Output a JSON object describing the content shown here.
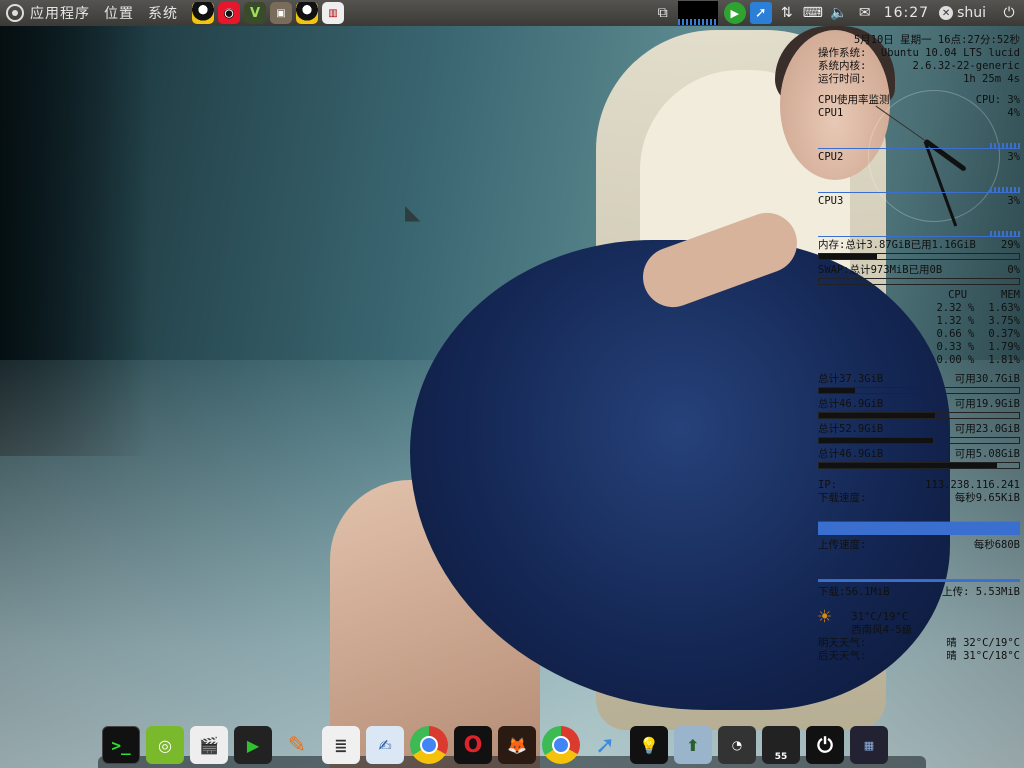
{
  "top_panel": {
    "menus": [
      "应用程序",
      "位置",
      "系统"
    ],
    "clock": "16:27",
    "user": "shui"
  },
  "conky": {
    "datetime": "5月10日 星期一 16点:27分:52秒",
    "os_label": "操作系统:",
    "os_value": "Ubuntu 10.04 LTS lucid",
    "kernel_label": "系统内核:",
    "kernel_value": "2.6.32-22-generic",
    "uptime_label": "运行时间:",
    "uptime_value": "1h 25m 4s",
    "cpu_label": "CPU使用率监测",
    "cpu_total": "CPU: 3%",
    "cpus": [
      {
        "name": "CPU1",
        "value": "4%"
      },
      {
        "name": "CPU2",
        "value": "3%"
      },
      {
        "name": "CPU3",
        "value": "3%"
      }
    ],
    "mem_label": "内存:总计3.87GiB已用1.16GiB",
    "mem_pct": "29%",
    "mem_fraction": 0.29,
    "swap_label": "SWAP:总计973MiB已用0B",
    "swap_pct": "0%",
    "swap_fraction": 0.0,
    "proc_header_cpu": "CPU",
    "proc_header_mem": "MEM",
    "procs": [
      {
        "name": "",
        "cpu": "2.32 %",
        "mem": "1.63%"
      },
      {
        "name": "",
        "cpu": "1.32 %",
        "mem": "3.75%"
      },
      {
        "name": "",
        "cpu": "0.66 %",
        "mem": "0.37%"
      },
      {
        "name": "",
        "cpu": "0.33 %",
        "mem": "1.79%"
      },
      {
        "name": "",
        "cpu": "0.00 %",
        "mem": "1.81%"
      }
    ],
    "disks": [
      {
        "label": "总计37.3GiB",
        "free": "可用30.7GiB",
        "fraction": 0.18
      },
      {
        "label": "总计46.9GiB",
        "free": "可用19.9GiB",
        "fraction": 0.58
      },
      {
        "label": "总计52.9GiB",
        "free": "可用23.0GiB",
        "fraction": 0.57
      },
      {
        "label": "总计46.9GiB",
        "free": "可用5.08GiB",
        "fraction": 0.89
      }
    ],
    "ip_label": "IP:",
    "ip_value": "113.238.116.241",
    "down_label": "下载速度:",
    "down_value": "每秒9.65KiB",
    "up_label": "上传速度:",
    "up_value": "每秒680B",
    "total_down": "下载:56.1MiB",
    "total_up": "上传: 5.53MiB",
    "weather_today": "31°C/19°C",
    "weather_wind": "西南风4-5级",
    "tomorrow_label": "明天天气:",
    "tomorrow_value": "晴 32°C/19°C",
    "after_label": "后天天气:",
    "after_value": "晴 31°C/18°C"
  },
  "dock": {
    "gauge_value": "55"
  }
}
